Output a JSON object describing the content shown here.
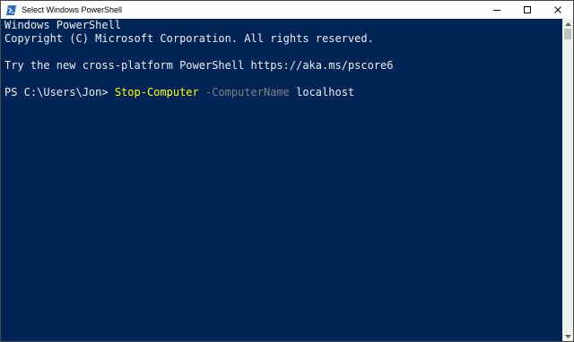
{
  "window": {
    "title": "Select Windows PowerShell",
    "icon": "powershell-icon",
    "controls": [
      "minimize-icon",
      "maximize-icon",
      "close-icon"
    ]
  },
  "console": {
    "banner_line1": "Windows PowerShell",
    "banner_line2": "Copyright (C) Microsoft Corporation. All rights reserved.",
    "banner_line3": "Try the new cross-platform PowerShell https://aka.ms/pscore6",
    "prompt": "PS C:\\Users\\Jon> ",
    "command": "Stop-Computer",
    "parameter": " -ComputerName",
    "argument": " localhost"
  },
  "colors": {
    "background": "#012456",
    "text": "#eeedf0",
    "command": "#ffff00",
    "parameter": "#808080"
  }
}
